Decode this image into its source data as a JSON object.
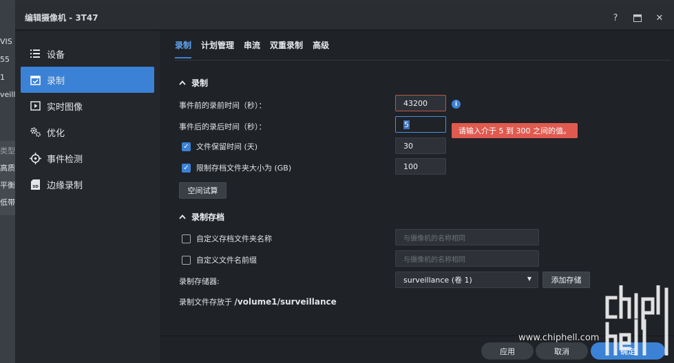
{
  "background": {
    "fragments": [
      "VIS",
      "55",
      "1",
      "veill",
      "类型",
      "高质",
      "平衡",
      "低带"
    ]
  },
  "dialog": {
    "title": "编辑摄像机 - 3T47",
    "title_actions": [
      "?",
      "▣",
      "✕"
    ]
  },
  "sidebar": {
    "items": [
      {
        "label": "设备",
        "icon": "list-icon"
      },
      {
        "label": "录制",
        "icon": "calendar-check-icon",
        "active": true
      },
      {
        "label": "实时图像",
        "icon": "play-icon"
      },
      {
        "label": "优化",
        "icon": "gears-icon"
      },
      {
        "label": "事件检测",
        "icon": "crosshair-icon"
      },
      {
        "label": "边缘录制",
        "icon": "sd-card-icon"
      }
    ]
  },
  "tabs": [
    {
      "label": "录制",
      "active": true
    },
    {
      "label": "计划管理"
    },
    {
      "label": "串流"
    },
    {
      "label": "双重录制"
    },
    {
      "label": "高级"
    }
  ],
  "record_section": {
    "title": "录制",
    "pre_event_label": "事件前的录前时间（秒）：",
    "pre_event_value": "43200",
    "post_event_label": "事件后的录后时间（秒）：",
    "post_event_value": "5",
    "error_tooltip": "请输入介于 5 到 300 之间的值。",
    "retention_label": "文件保留时间 (天)",
    "retention_value": "30",
    "retention_checked": true,
    "limit_size_label": "限制存档文件夹大小为 (GB)",
    "limit_size_value": "100",
    "limit_size_checked": true,
    "estimate_button": "空间试算"
  },
  "archive_section": {
    "title": "录制存档",
    "custom_folder_label": "自定义存档文件夹名称",
    "custom_folder_placeholder": "与摄像机的名称相同",
    "custom_prefix_label": "自定义文件名前缀",
    "custom_prefix_placeholder": "与摄像机的名称相同",
    "storage_label": "录制存储器:",
    "storage_value": "surveillance (卷 1)",
    "add_storage_button": "添加存储",
    "path_label": "录制文件存放于",
    "path_value": "/volume1/surveillance"
  },
  "footer": {
    "apply": "应用",
    "cancel": "取消",
    "ok": "确定"
  },
  "watermark": {
    "url": "www.chiphell.com"
  },
  "colors": {
    "accent": "#3b82d6",
    "error": "#e05a4f",
    "dialog_bg": "#1f2227",
    "sidebar_bg": "#24272c"
  }
}
